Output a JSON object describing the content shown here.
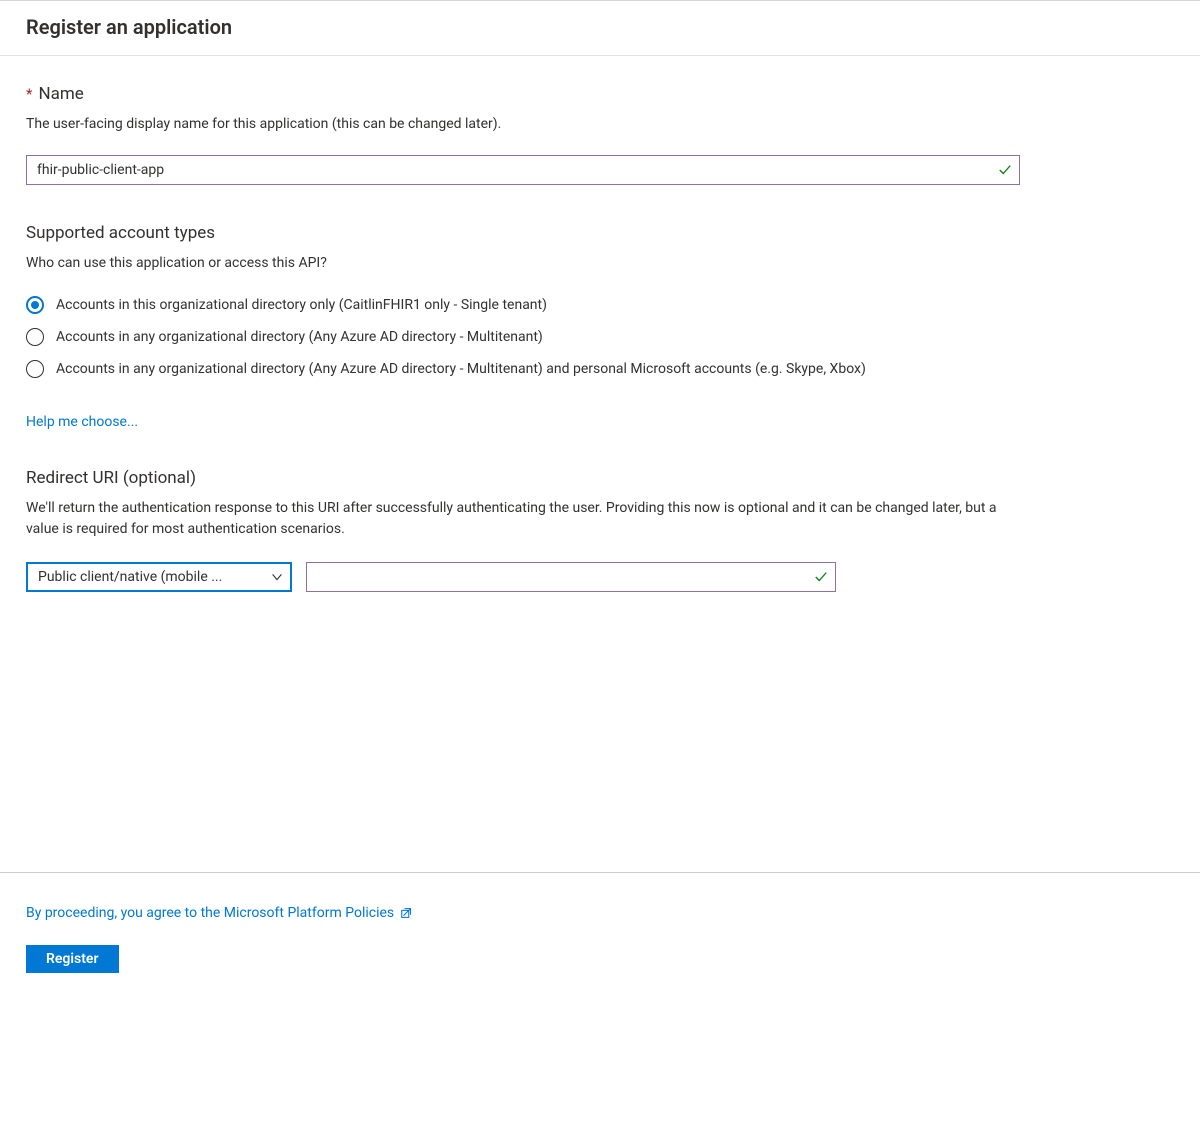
{
  "page_title": "Register an application",
  "name_section": {
    "label": "Name",
    "required_marker": "*",
    "description": "The user-facing display name for this application (this can be changed later).",
    "value": "fhir-public-client-app"
  },
  "account_types_section": {
    "heading": "Supported account types",
    "description": "Who can use this application or access this API?",
    "options": [
      {
        "label": "Accounts in this organizational directory only (CaitlinFHIR1 only - Single tenant)",
        "selected": true
      },
      {
        "label": "Accounts in any organizational directory (Any Azure AD directory - Multitenant)",
        "selected": false
      },
      {
        "label": "Accounts in any organizational directory (Any Azure AD directory - Multitenant) and personal Microsoft accounts (e.g. Skype, Xbox)",
        "selected": false
      }
    ],
    "help_link": "Help me choose..."
  },
  "redirect_uri_section": {
    "heading": "Redirect URI (optional)",
    "description": "We'll return the authentication response to this URI after successfully authenticating the user. Providing this now is optional and it can be changed later, but a value is required for most authentication scenarios.",
    "platform_selected_display": "Public client/native (mobile ...",
    "uri_value": ""
  },
  "footer": {
    "policies_link": "By proceeding, you agree to the Microsoft Platform Policies",
    "register_button": "Register"
  }
}
